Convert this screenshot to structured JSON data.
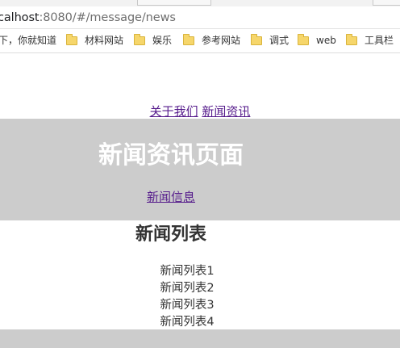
{
  "browser": {
    "url_host": "calhost",
    "url_path": ":8080/#/message/news",
    "bookmarks": [
      {
        "label": "下，你就知道",
        "folder": false
      },
      {
        "label": "材料网站",
        "folder": true
      },
      {
        "label": "娱乐",
        "folder": true
      },
      {
        "label": "参考网站",
        "folder": true
      },
      {
        "label": "调式",
        "folder": true
      },
      {
        "label": "web",
        "folder": true
      },
      {
        "label": "工具栏",
        "folder": true
      }
    ]
  },
  "nav": {
    "about": "关于我们",
    "news": "新闻资讯"
  },
  "banner": {
    "title": "新闻资讯页面",
    "sublink": "新闻信息"
  },
  "list": {
    "title": "新闻列表",
    "items": [
      "新闻列表1",
      "新闻列表2",
      "新闻列表3",
      "新闻列表4"
    ]
  },
  "colors": {
    "banner_bg": "#cccccc",
    "visited_link": "#551a8b",
    "folder_icon": "#f6d66b"
  }
}
